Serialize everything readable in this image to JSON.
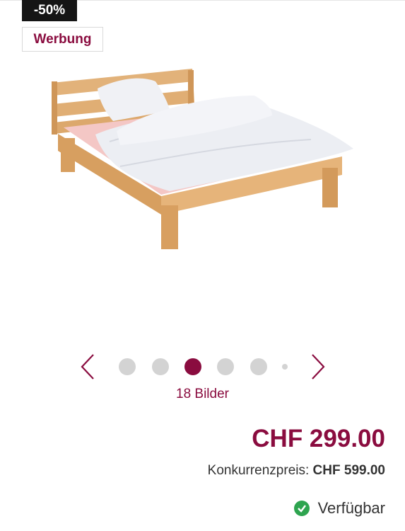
{
  "badges": {
    "discount": "-50%",
    "ad": "Werbung"
  },
  "product": {
    "image_icon": "bed-product-image"
  },
  "carousel": {
    "prev_icon": "chevron-left-icon",
    "next_icon": "chevron-right-icon",
    "active_index": 2,
    "dot_count": 6,
    "image_count_label": "18 Bilder"
  },
  "pricing": {
    "price": "CHF 299.00",
    "competitor_label": "Konkurrenzpreis:",
    "competitor_price": "CHF 599.00"
  },
  "availability": {
    "icon": "check-circle-icon",
    "label": "Verfügbar"
  },
  "colors": {
    "accent": "#8a0c3f",
    "badge_bg": "#151515",
    "dot_inactive": "#d3d3d3",
    "available": "#2ea44f"
  }
}
